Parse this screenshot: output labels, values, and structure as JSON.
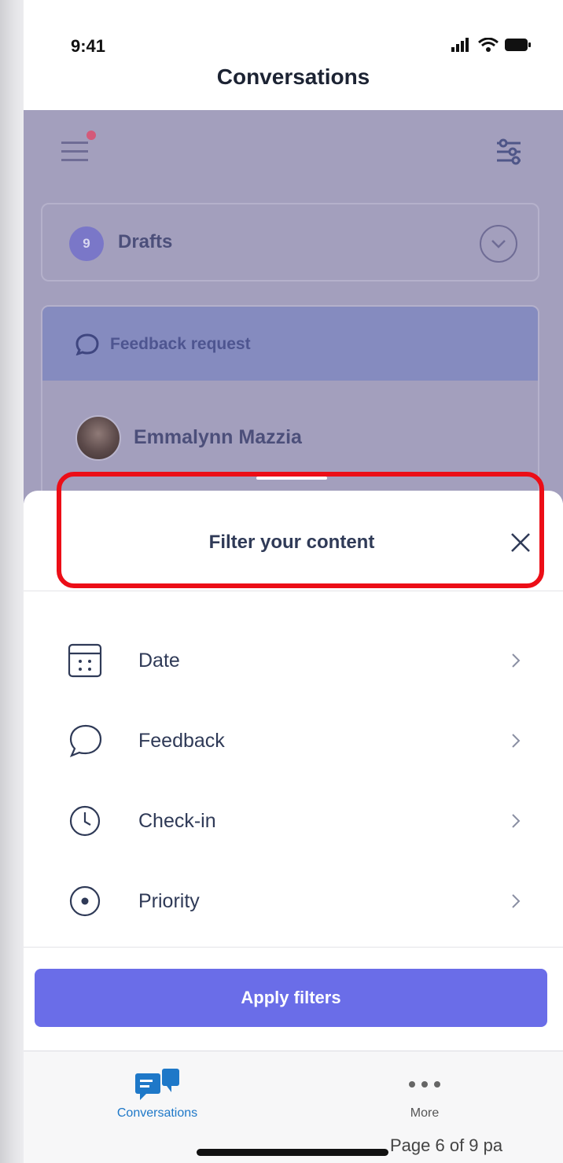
{
  "status_bar": {
    "time": "9:41"
  },
  "screen": {
    "title": "Conversations"
  },
  "background": {
    "drafts": {
      "count": "9",
      "label": "Drafts"
    },
    "feedback_card": {
      "title": "Feedback request",
      "person": "Emmalynn Mazzia"
    }
  },
  "sheet": {
    "title": "Filter your content",
    "filters": [
      {
        "label": "Date",
        "icon": "calendar-icon"
      },
      {
        "label": "Feedback",
        "icon": "speech-bubble-icon"
      },
      {
        "label": "Check-in",
        "icon": "clock-icon"
      },
      {
        "label": "Priority",
        "icon": "target-dot-icon"
      }
    ],
    "apply_label": "Apply filters"
  },
  "tabs": [
    {
      "label": "Conversations",
      "icon": "conversations-icon",
      "active": true
    },
    {
      "label": "More",
      "icon": "more-dots-icon",
      "active": false
    }
  ],
  "footer": {
    "page_text": "Page 6 of 9 pa"
  },
  "colors": {
    "accent": "#6a6de8",
    "overlay": "#a39fbd",
    "highlight": "#ec0e17",
    "tab_active": "#1e78c8"
  }
}
